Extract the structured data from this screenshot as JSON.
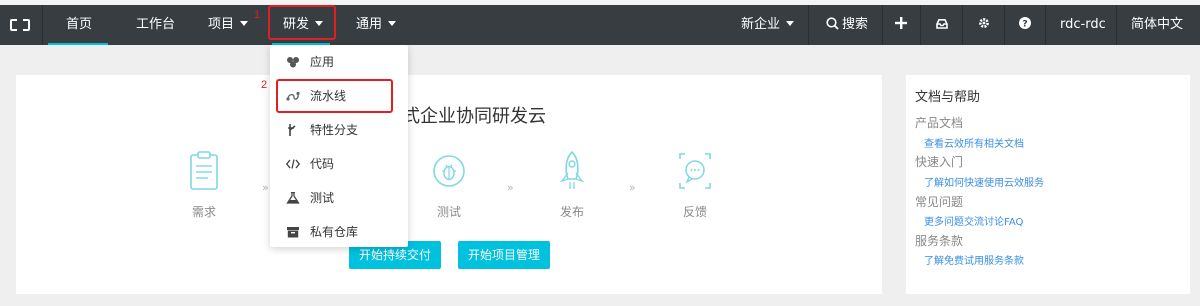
{
  "navbar": {
    "items": [
      {
        "label": "首页"
      },
      {
        "label": "工作台"
      },
      {
        "label": "项目"
      },
      {
        "label": "研发"
      },
      {
        "label": "通用"
      }
    ],
    "right": {
      "company": "新企业",
      "search": "搜索",
      "user": "rdc-rdc",
      "language": "简体中文"
    },
    "icons": [
      "logo-icon",
      "plus-icon",
      "inbox-icon",
      "gear-icon",
      "help-icon"
    ]
  },
  "annotations": [
    {
      "number": "1"
    },
    {
      "number": "2"
    }
  ],
  "dropdown": {
    "items": [
      {
        "label": "应用",
        "icon": "app-icon"
      },
      {
        "label": "流水线",
        "icon": "pipeline-icon"
      },
      {
        "label": "特性分支",
        "icon": "branch-icon"
      },
      {
        "label": "代码",
        "icon": "code-icon"
      },
      {
        "label": "测试",
        "icon": "flask-icon"
      },
      {
        "label": "私有仓库",
        "icon": "box-icon"
      }
    ]
  },
  "main": {
    "title_visible": "式企业协同研发云",
    "steps": [
      {
        "label": "需求",
        "icon": "clipboard-icon"
      },
      {
        "label": "测试",
        "icon": "bug-icon"
      },
      {
        "label": "发布",
        "icon": "rocket-icon"
      },
      {
        "label": "反馈",
        "icon": "feedback-icon"
      }
    ],
    "chevron": "»",
    "buttons": [
      {
        "label": "开始持续交付"
      },
      {
        "label": "开始项目管理"
      }
    ]
  },
  "help": {
    "title": "文档与帮助",
    "sections": [
      {
        "heading": "产品文档",
        "link": "查看云效所有相关文档"
      },
      {
        "heading": "快速入门",
        "link": "了解如何快速使用云效服务"
      },
      {
        "heading": "常见问题",
        "link": "更多问题交流讨论FAQ"
      },
      {
        "heading": "服务条款",
        "link": "了解免费试用服务条款"
      }
    ]
  },
  "colors": {
    "navbar": "#373d41",
    "accent": "#00c1de",
    "annotation": "#e02020",
    "link": "#3a8ee6"
  }
}
